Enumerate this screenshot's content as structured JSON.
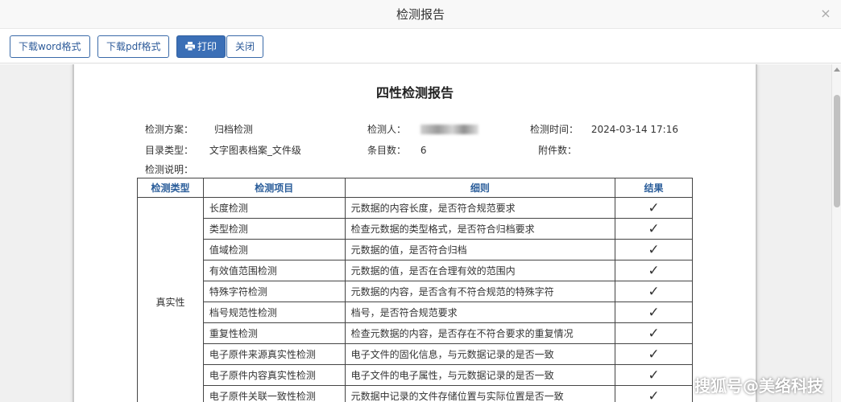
{
  "dialog": {
    "title": "检测报告",
    "close_glyph": "×"
  },
  "toolbar": {
    "download_word": "下载word格式",
    "download_pdf": "下载pdf格式",
    "print": "打印",
    "close": "关闭"
  },
  "report": {
    "title": "四性检测报告",
    "meta": {
      "scheme_label": "检测方案：",
      "scheme_value": "归档检测",
      "inspector_label": "检测人：",
      "time_label": "检测时间：",
      "time_value": "2024-03-14 17:16",
      "catalog_label": "目录类型：",
      "catalog_value": "文字图表档案_文件级",
      "count_label": "条目数：",
      "count_value": "6",
      "attach_label": "附件数：",
      "desc_label": "检测说明："
    },
    "table": {
      "headers": [
        "检测类型",
        "检测项目",
        "细则",
        "结果"
      ],
      "type_label": "真实性",
      "rows": [
        {
          "item": "长度检测",
          "detail": "元数据的内容长度，是否符合规范要求",
          "result": "✓"
        },
        {
          "item": "类型检测",
          "detail": "检查元数据的类型格式，是否符合归档要求",
          "result": "✓"
        },
        {
          "item": "值域检测",
          "detail": "元数据的值，是否符合归档",
          "result": "✓"
        },
        {
          "item": "有效值范围检测",
          "detail": "元数据的值，是否在合理有效的范围内",
          "result": "✓"
        },
        {
          "item": "特殊字符检测",
          "detail": "元数据的内容，是否含有不符合规范的特殊字符",
          "result": "✓"
        },
        {
          "item": "档号规范性检测",
          "detail": "档号，是否符合规范要求",
          "result": "✓"
        },
        {
          "item": "重复性检测",
          "detail": "检查元数据的内容，是否存在不符合要求的重复情况",
          "result": "✓"
        },
        {
          "item": "电子原件来源真实性检测",
          "detail": "电子文件的固化信息，与元数据记录的是否一致",
          "result": "✓"
        },
        {
          "item": "电子原件内容真实性检测",
          "detail": "电子文件的电子属性，与元数据记录的是否一致",
          "result": "✓"
        },
        {
          "item": "电子原件关联一致性检测",
          "detail": "元数据中记录的文件存储位置与实际位置是否一致",
          "result": "✓"
        }
      ]
    }
  },
  "watermark": "搜狐号@美络科技",
  "colors": {
    "accent": "#3b6fb6",
    "header_text": "#2a5d9a",
    "check": "#1f4f1f"
  }
}
